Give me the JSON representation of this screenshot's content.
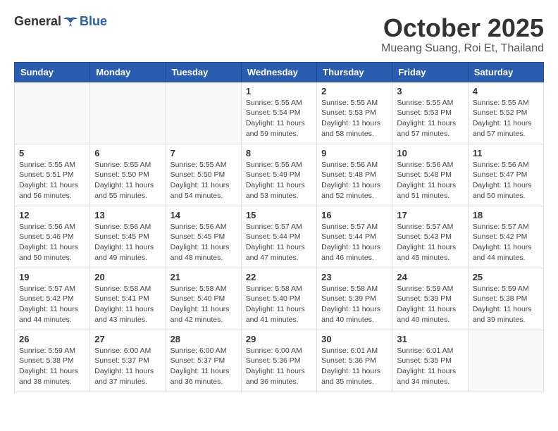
{
  "header": {
    "logo_general": "General",
    "logo_blue": "Blue",
    "month_title": "October 2025",
    "subtitle": "Mueang Suang, Roi Et, Thailand"
  },
  "weekdays": [
    "Sunday",
    "Monday",
    "Tuesday",
    "Wednesday",
    "Thursday",
    "Friday",
    "Saturday"
  ],
  "weeks": [
    [
      {
        "day": "",
        "info": ""
      },
      {
        "day": "",
        "info": ""
      },
      {
        "day": "",
        "info": ""
      },
      {
        "day": "1",
        "info": "Sunrise: 5:55 AM\nSunset: 5:54 PM\nDaylight: 11 hours\nand 59 minutes."
      },
      {
        "day": "2",
        "info": "Sunrise: 5:55 AM\nSunset: 5:53 PM\nDaylight: 11 hours\nand 58 minutes."
      },
      {
        "day": "3",
        "info": "Sunrise: 5:55 AM\nSunset: 5:53 PM\nDaylight: 11 hours\nand 57 minutes."
      },
      {
        "day": "4",
        "info": "Sunrise: 5:55 AM\nSunset: 5:52 PM\nDaylight: 11 hours\nand 57 minutes."
      }
    ],
    [
      {
        "day": "5",
        "info": "Sunrise: 5:55 AM\nSunset: 5:51 PM\nDaylight: 11 hours\nand 56 minutes."
      },
      {
        "day": "6",
        "info": "Sunrise: 5:55 AM\nSunset: 5:50 PM\nDaylight: 11 hours\nand 55 minutes."
      },
      {
        "day": "7",
        "info": "Sunrise: 5:55 AM\nSunset: 5:50 PM\nDaylight: 11 hours\nand 54 minutes."
      },
      {
        "day": "8",
        "info": "Sunrise: 5:55 AM\nSunset: 5:49 PM\nDaylight: 11 hours\nand 53 minutes."
      },
      {
        "day": "9",
        "info": "Sunrise: 5:56 AM\nSunset: 5:48 PM\nDaylight: 11 hours\nand 52 minutes."
      },
      {
        "day": "10",
        "info": "Sunrise: 5:56 AM\nSunset: 5:48 PM\nDaylight: 11 hours\nand 51 minutes."
      },
      {
        "day": "11",
        "info": "Sunrise: 5:56 AM\nSunset: 5:47 PM\nDaylight: 11 hours\nand 50 minutes."
      }
    ],
    [
      {
        "day": "12",
        "info": "Sunrise: 5:56 AM\nSunset: 5:46 PM\nDaylight: 11 hours\nand 50 minutes."
      },
      {
        "day": "13",
        "info": "Sunrise: 5:56 AM\nSunset: 5:45 PM\nDaylight: 11 hours\nand 49 minutes."
      },
      {
        "day": "14",
        "info": "Sunrise: 5:56 AM\nSunset: 5:45 PM\nDaylight: 11 hours\nand 48 minutes."
      },
      {
        "day": "15",
        "info": "Sunrise: 5:57 AM\nSunset: 5:44 PM\nDaylight: 11 hours\nand 47 minutes."
      },
      {
        "day": "16",
        "info": "Sunrise: 5:57 AM\nSunset: 5:44 PM\nDaylight: 11 hours\nand 46 minutes."
      },
      {
        "day": "17",
        "info": "Sunrise: 5:57 AM\nSunset: 5:43 PM\nDaylight: 11 hours\nand 45 minutes."
      },
      {
        "day": "18",
        "info": "Sunrise: 5:57 AM\nSunset: 5:42 PM\nDaylight: 11 hours\nand 44 minutes."
      }
    ],
    [
      {
        "day": "19",
        "info": "Sunrise: 5:57 AM\nSunset: 5:42 PM\nDaylight: 11 hours\nand 44 minutes."
      },
      {
        "day": "20",
        "info": "Sunrise: 5:58 AM\nSunset: 5:41 PM\nDaylight: 11 hours\nand 43 minutes."
      },
      {
        "day": "21",
        "info": "Sunrise: 5:58 AM\nSunset: 5:40 PM\nDaylight: 11 hours\nand 42 minutes."
      },
      {
        "day": "22",
        "info": "Sunrise: 5:58 AM\nSunset: 5:40 PM\nDaylight: 11 hours\nand 41 minutes."
      },
      {
        "day": "23",
        "info": "Sunrise: 5:58 AM\nSunset: 5:39 PM\nDaylight: 11 hours\nand 40 minutes."
      },
      {
        "day": "24",
        "info": "Sunrise: 5:59 AM\nSunset: 5:39 PM\nDaylight: 11 hours\nand 40 minutes."
      },
      {
        "day": "25",
        "info": "Sunrise: 5:59 AM\nSunset: 5:38 PM\nDaylight: 11 hours\nand 39 minutes."
      }
    ],
    [
      {
        "day": "26",
        "info": "Sunrise: 5:59 AM\nSunset: 5:38 PM\nDaylight: 11 hours\nand 38 minutes."
      },
      {
        "day": "27",
        "info": "Sunrise: 6:00 AM\nSunset: 5:37 PM\nDaylight: 11 hours\nand 37 minutes."
      },
      {
        "day": "28",
        "info": "Sunrise: 6:00 AM\nSunset: 5:37 PM\nDaylight: 11 hours\nand 36 minutes."
      },
      {
        "day": "29",
        "info": "Sunrise: 6:00 AM\nSunset: 5:36 PM\nDaylight: 11 hours\nand 36 minutes."
      },
      {
        "day": "30",
        "info": "Sunrise: 6:01 AM\nSunset: 5:36 PM\nDaylight: 11 hours\nand 35 minutes."
      },
      {
        "day": "31",
        "info": "Sunrise: 6:01 AM\nSunset: 5:35 PM\nDaylight: 11 hours\nand 34 minutes."
      },
      {
        "day": "",
        "info": ""
      }
    ]
  ]
}
